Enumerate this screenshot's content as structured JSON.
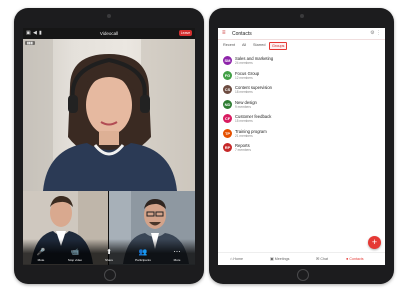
{
  "call": {
    "title": "Videocall",
    "leave_label": "Leave",
    "controls": [
      {
        "icon": "microphone-icon",
        "glyph": "🎤",
        "label": "Mute"
      },
      {
        "icon": "video-camera-icon",
        "glyph": "📹",
        "label": "Stop video"
      },
      {
        "icon": "share-icon",
        "glyph": "⬆",
        "label": "Share"
      },
      {
        "icon": "participants-icon",
        "glyph": "👥",
        "label": "Participants"
      },
      {
        "icon": "more-icon",
        "glyph": "⋯",
        "label": "More"
      }
    ]
  },
  "contacts": {
    "title": "Contacts",
    "tabs": [
      "Recent",
      "All",
      "Starred",
      "Groups"
    ],
    "active_tab": "Groups",
    "groups": [
      {
        "initials": "SM",
        "name": "Sales and marketing",
        "members": "24 members",
        "color": "#8e24aa"
      },
      {
        "initials": "FG",
        "name": "Focus Group",
        "members": "12 members",
        "color": "#43a047"
      },
      {
        "initials": "CS",
        "name": "Content supervision",
        "members": "18 members",
        "color": "#6d4c41"
      },
      {
        "initials": "ND",
        "name": "New design",
        "members": "9 members",
        "color": "#2e7d32"
      },
      {
        "initials": "CF",
        "name": "Customer feedback",
        "members": "15 members",
        "color": "#d81b60"
      },
      {
        "initials": "TP",
        "name": "Training program",
        "members": "21 members",
        "color": "#e65100"
      },
      {
        "initials": "RP",
        "name": "Reports",
        "members": "7 members",
        "color": "#c62828"
      }
    ],
    "bottom_nav": [
      {
        "icon": "home-icon",
        "glyph": "⌂",
        "label": "Home"
      },
      {
        "icon": "meetings-icon",
        "glyph": "▣",
        "label": "Meetings"
      },
      {
        "icon": "chat-icon",
        "glyph": "✉",
        "label": "Chat"
      },
      {
        "icon": "contacts-icon",
        "glyph": "●",
        "label": "Contacts"
      }
    ],
    "accent_color": "#e53935"
  }
}
